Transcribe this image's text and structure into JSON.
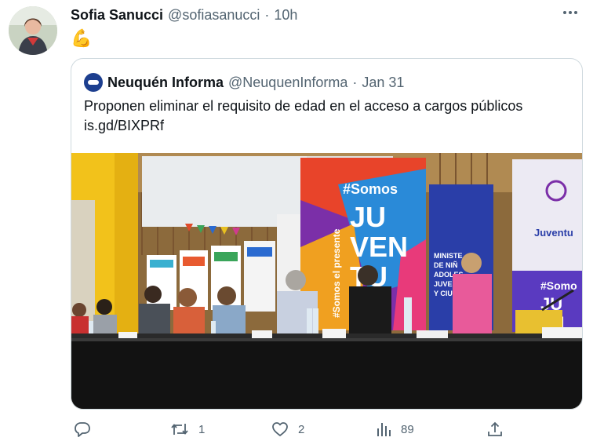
{
  "tweet": {
    "author_name": "Sofia Sanucci",
    "handle": "@sofiasanucci",
    "separator": "·",
    "time": "10h",
    "text": "💪"
  },
  "quote": {
    "author_name": "Neuquén Informa",
    "handle": "@NeuquenInforma",
    "separator": "·",
    "date": "Jan 31",
    "text_line1": "Proponen eliminar el requisito de edad en el acceso a cargos públicos",
    "text_line2": "is.gd/BIXPRf",
    "image": {
      "banner_hashtag": "#Somos",
      "banner_big_text": "JU VEN TU D",
      "banner_side_text": "#Somos el presente",
      "ministry_text": "MINISTE DE NIÑ ADOLES JUVE Y CIUDA",
      "right_banner_text": "Juventu",
      "right_banner_hashtag": "#Somo"
    }
  },
  "actions": {
    "reply_count": "",
    "retweet_count": "1",
    "like_count": "2",
    "views_count": "89"
  },
  "colors": {
    "text_primary": "#0f1419",
    "text_secondary": "#536471",
    "border": "#cfd9de",
    "quote_avatar": "#1d3f8f"
  }
}
